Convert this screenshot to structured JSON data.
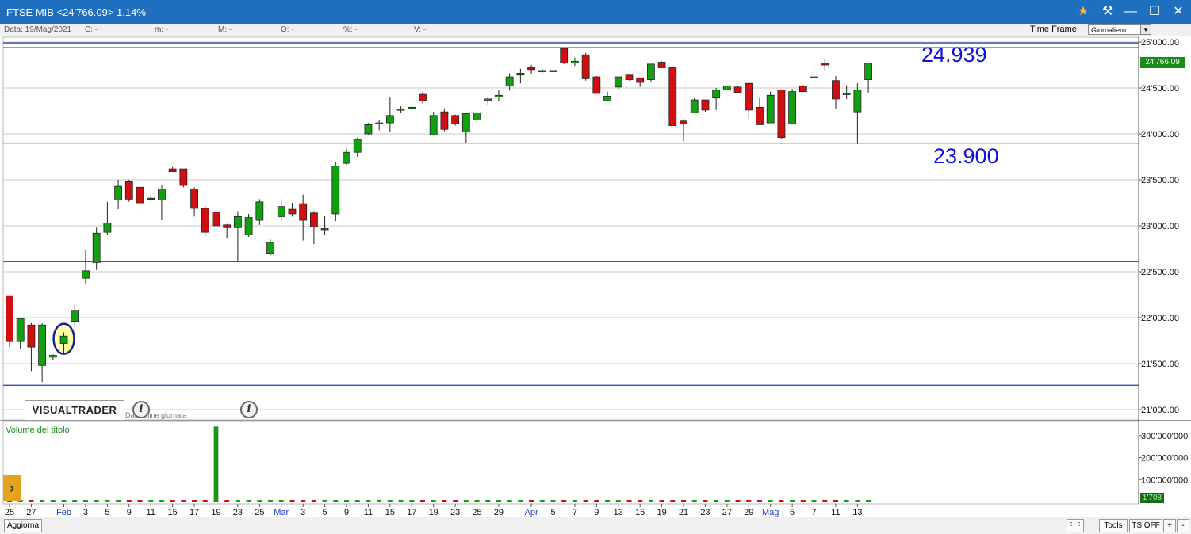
{
  "window": {
    "title": "FTSE MIB <24'766.09>  1.14%",
    "controls": {
      "favorite": "★",
      "tool": "⚒",
      "minimize": "—",
      "maximize": "☐",
      "close": "✕"
    }
  },
  "info_bar": {
    "data": "Data: 19/Mag/2021",
    "close": "C: -",
    "min": "m: -",
    "max": "M: -",
    "open": "O: -",
    "pct": "%: -",
    "volume": "V: -"
  },
  "time_frame": {
    "label": "Time Frame",
    "selected": "Giornaliero"
  },
  "annotations": {
    "resistance_label": "24.939",
    "support_label": "23.900"
  },
  "logo": {
    "text": "VISUALTRADER",
    "subtitle": "Dati di fine giornata"
  },
  "volume_panel": {
    "label": "Volume del titolo"
  },
  "tags": {
    "last_price": "24'766.09",
    "last_volume": "1'708"
  },
  "bottom": {
    "refresh": "Aggiorna",
    "tools": "Tools",
    "ts": "TS OFF",
    "plus": "+",
    "minus": "-"
  },
  "colors": {
    "up": "#12a012",
    "down": "#d01010",
    "hline": "#1a3fb0",
    "title_bar": "#1f6fbf",
    "annotation": "#1010e0",
    "highlight": "#ffff99"
  },
  "chart_data": {
    "type": "candlestick",
    "ylim": [
      20950,
      25020
    ],
    "y_ticks": [
      "25'000.00",
      "24'500.00",
      "24'000.00",
      "23'500.00",
      "23'000.00",
      "22'500.00",
      "22'000.00",
      "21'500.00",
      "21'000.00"
    ],
    "horizontal_lines": [
      24939,
      23900,
      22610,
      21265,
      24990
    ],
    "x_labels": [
      {
        "label": "25",
        "i": 0
      },
      {
        "label": "27",
        "i": 2
      },
      {
        "label": "Feb",
        "i": 5,
        "month": true
      },
      {
        "label": "3",
        "i": 7
      },
      {
        "label": "5",
        "i": 9
      },
      {
        "label": "9",
        "i": 11
      },
      {
        "label": "11",
        "i": 13
      },
      {
        "label": "15",
        "i": 15
      },
      {
        "label": "17",
        "i": 17
      },
      {
        "label": "19",
        "i": 19
      },
      {
        "label": "23",
        "i": 21
      },
      {
        "label": "25",
        "i": 23
      },
      {
        "label": "Mar",
        "i": 25,
        "month": true
      },
      {
        "label": "3",
        "i": 27
      },
      {
        "label": "5",
        "i": 29
      },
      {
        "label": "9",
        "i": 31
      },
      {
        "label": "11",
        "i": 33
      },
      {
        "label": "15",
        "i": 35
      },
      {
        "label": "17",
        "i": 37
      },
      {
        "label": "19",
        "i": 39
      },
      {
        "label": "23",
        "i": 41
      },
      {
        "label": "25",
        "i": 43
      },
      {
        "label": "29",
        "i": 45
      },
      {
        "label": "Apr",
        "i": 48,
        "month": true
      },
      {
        "label": "5",
        "i": 50
      },
      {
        "label": "7",
        "i": 52
      },
      {
        "label": "9",
        "i": 54
      },
      {
        "label": "13",
        "i": 56
      },
      {
        "label": "15",
        "i": 58
      },
      {
        "label": "19",
        "i": 60
      },
      {
        "label": "21",
        "i": 62
      },
      {
        "label": "23",
        "i": 64
      },
      {
        "label": "27",
        "i": 66
      },
      {
        "label": "29",
        "i": 68
      },
      {
        "label": "Mag",
        "i": 70,
        "month": true
      },
      {
        "label": "5",
        "i": 72
      },
      {
        "label": "7",
        "i": 74
      },
      {
        "label": "11",
        "i": 76
      },
      {
        "label": "13",
        "i": 78
      }
    ],
    "ohlc": [
      [
        22240,
        22240,
        21680,
        21740
      ],
      [
        21740,
        22000,
        21660,
        21990
      ],
      [
        21920,
        21940,
        21420,
        21680
      ],
      [
        21480,
        21940,
        21300,
        21920
      ],
      [
        21570,
        21600,
        21540,
        21590
      ],
      [
        21720,
        21840,
        21620,
        21800
      ],
      [
        21960,
        22140,
        21920,
        22080
      ],
      [
        22430,
        22740,
        22360,
        22510
      ],
      [
        22600,
        22980,
        22520,
        22920
      ],
      [
        22930,
        23260,
        22900,
        23030
      ],
      [
        23280,
        23500,
        23180,
        23430
      ],
      [
        23480,
        23500,
        23260,
        23290
      ],
      [
        23420,
        23420,
        23130,
        23250
      ],
      [
        23290,
        23320,
        23270,
        23300
      ],
      [
        23280,
        23440,
        23060,
        23400
      ],
      [
        23620,
        23640,
        23590,
        23590
      ],
      [
        23620,
        23620,
        23420,
        23440
      ],
      [
        23400,
        23420,
        23100,
        23190
      ],
      [
        23190,
        23220,
        22890,
        22930
      ],
      [
        23150,
        23160,
        22900,
        23000
      ],
      [
        23010,
        23020,
        22860,
        22980
      ],
      [
        22980,
        23160,
        22620,
        23100
      ],
      [
        22900,
        23130,
        22880,
        23090
      ],
      [
        23060,
        23290,
        23010,
        23260
      ],
      [
        22700,
        22850,
        22680,
        22820
      ],
      [
        23100,
        23290,
        23050,
        23210
      ],
      [
        23180,
        23250,
        23100,
        23130
      ],
      [
        23240,
        23340,
        22840,
        23060
      ],
      [
        23140,
        23160,
        22800,
        22990
      ],
      [
        22960,
        23110,
        22900,
        22970
      ],
      [
        23130,
        23700,
        23050,
        23650
      ],
      [
        23680,
        23840,
        23660,
        23800
      ],
      [
        23800,
        23960,
        23750,
        23940
      ],
      [
        24000,
        24120,
        23990,
        24100
      ],
      [
        24110,
        24150,
        24040,
        24120
      ],
      [
        24120,
        24400,
        24020,
        24200
      ],
      [
        24260,
        24300,
        24230,
        24270
      ],
      [
        24280,
        24300,
        24260,
        24290
      ],
      [
        24430,
        24460,
        24330,
        24360
      ],
      [
        23990,
        24240,
        23980,
        24200
      ],
      [
        24240,
        24270,
        24030,
        24050
      ],
      [
        24200,
        24210,
        24090,
        24110
      ],
      [
        24020,
        24230,
        23900,
        24220
      ],
      [
        24150,
        24250,
        24140,
        24230
      ],
      [
        24370,
        24400,
        24320,
        24380
      ],
      [
        24400,
        24480,
        24360,
        24420
      ],
      [
        24520,
        24660,
        24470,
        24620
      ],
      [
        24640,
        24710,
        24550,
        24660
      ],
      [
        24720,
        24750,
        24650,
        24700
      ],
      [
        24680,
        24710,
        24660,
        24690
      ],
      [
        24690,
        24700,
        24680,
        24690
      ],
      [
        24930,
        24940,
        24760,
        24770
      ],
      [
        24770,
        24830,
        24740,
        24790
      ],
      [
        24860,
        24880,
        24580,
        24600
      ],
      [
        24620,
        24630,
        24450,
        24440
      ],
      [
        24360,
        24460,
        24390,
        24410
      ],
      [
        24510,
        24520,
        24480,
        24620
      ],
      [
        24640,
        24590,
        24580,
        24590
      ],
      [
        24610,
        24580,
        24510,
        24560
      ],
      [
        24590,
        24530,
        24570,
        24760
      ],
      [
        24780,
        24790,
        24740,
        24720
      ],
      [
        24720,
        23980,
        24090,
        24090
      ],
      [
        24140,
        24160,
        23920,
        24110
      ],
      [
        24230,
        24390,
        24240,
        24370
      ],
      [
        24370,
        24360,
        24240,
        24260
      ],
      [
        24390,
        24500,
        24260,
        24480
      ],
      [
        24480,
        24520,
        24480,
        24520
      ],
      [
        24510,
        24520,
        24470,
        24450
      ],
      [
        24550,
        24560,
        24170,
        24260
      ],
      [
        24290,
        24390,
        24220,
        24100
      ],
      [
        24120,
        24460,
        24120,
        24420
      ],
      [
        24480,
        24480,
        23950,
        23960
      ],
      [
        24110,
        24490,
        24100,
        24460
      ],
      [
        24520,
        24530,
        24460,
        24460
      ],
      [
        24620,
        24750,
        24450,
        24620
      ],
      [
        24770,
        24820,
        24690,
        24750
      ],
      [
        24580,
        24630,
        24270,
        24380
      ],
      [
        24430,
        24530,
        24380,
        24440
      ],
      [
        24240,
        24550,
        23890,
        24480
      ],
      [
        24590,
        24770,
        24450,
        24770
      ]
    ],
    "volume": {
      "spike_index": 19,
      "spike_value": 340000000,
      "ylim": [
        0,
        350000000
      ],
      "y_ticks": [
        "300'000'000",
        "200'000'000",
        "100'000'000"
      ]
    }
  }
}
